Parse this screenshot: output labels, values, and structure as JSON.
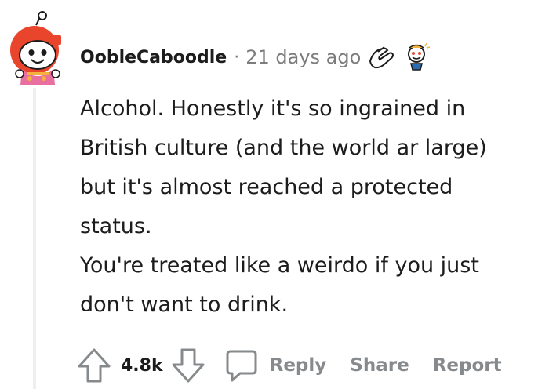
{
  "comment": {
    "username": "OobleCaboodle",
    "separator": "·",
    "time_ago": "21 days ago",
    "body": [
      "Alcohol. Honestly it's so ingrained in",
      "British culture (and the world ar large)",
      "but it's almost reached a protected",
      "status.",
      "You're treated like a weirdo if you just",
      "don't want to drink."
    ]
  },
  "actions": {
    "score": "4.8k",
    "reply_label": "Reply",
    "share_label": "Share",
    "report_label": "Report"
  },
  "colors": {
    "avatar_red": "#e8452c",
    "meta_gray": "#7c7c7c",
    "action_gray": "#878a8c"
  },
  "icons": {
    "avatar": "snoo-avatar-icon",
    "award_1": "hands-award-icon",
    "award_2": "snoo-award-icon",
    "upvote": "upvote-arrow-icon",
    "downvote": "downvote-arrow-icon",
    "reply": "chat-bubble-icon"
  }
}
